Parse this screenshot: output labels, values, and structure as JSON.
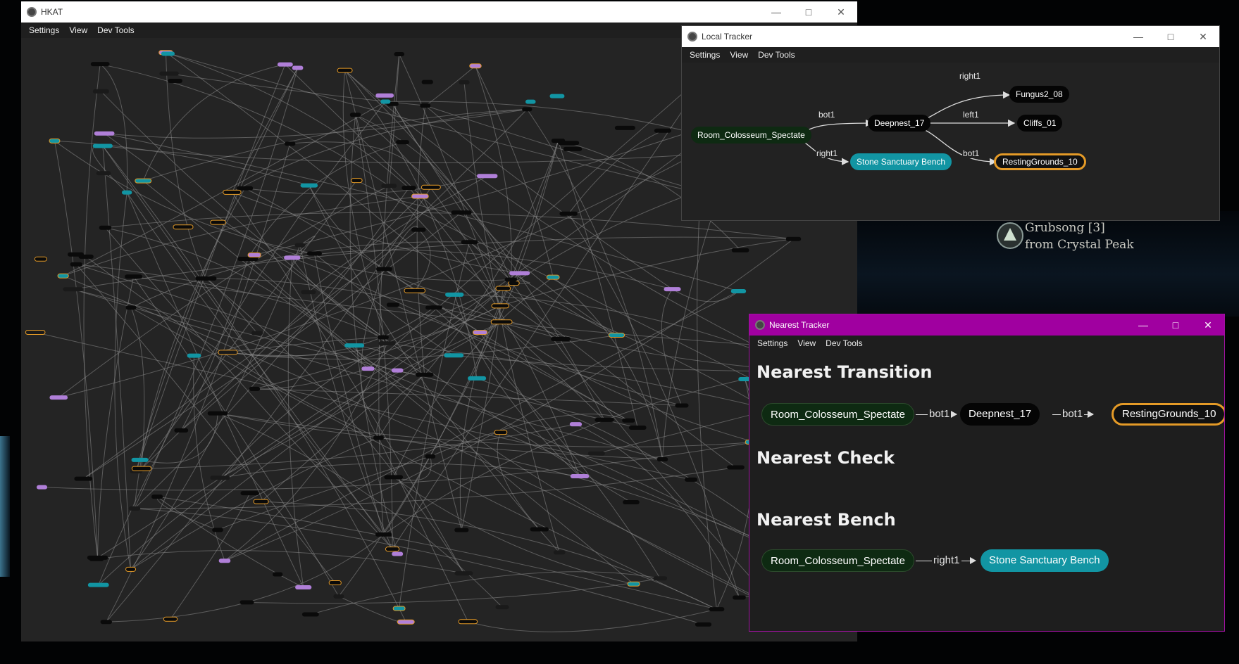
{
  "background": {
    "notice_line1": "Grubsong [3]",
    "notice_line2": "from Crystal Peak"
  },
  "hkat": {
    "title": "HKAT",
    "menu": [
      "Settings",
      "View",
      "Dev Tools"
    ]
  },
  "local_tracker": {
    "title": "Local Tracker",
    "menu": [
      "Settings",
      "View",
      "Dev Tools"
    ],
    "nodes": {
      "origin": "Room_Colosseum_Spectate",
      "deepnest": "Deepnest_17",
      "bench": "Stone Sanctuary Bench",
      "fungus": "Fungus2_08",
      "cliffs": "Cliffs_01",
      "resting": "RestingGrounds_10"
    },
    "edges": {
      "origin_deepnest": "bot1",
      "origin_bench": "right1",
      "deepnest_fungus": "right1",
      "deepnest_cliffs": "left1",
      "deepnest_resting": "bot1"
    }
  },
  "nearest_tracker": {
    "title": "Nearest Tracker",
    "menu": [
      "Settings",
      "View",
      "Dev Tools"
    ],
    "transition": {
      "heading": "Nearest Transition",
      "nodes": [
        "Room_Colosseum_Spectate",
        "Deepnest_17",
        "RestingGrounds_10"
      ],
      "edges": [
        "bot1",
        "bot1"
      ]
    },
    "check": {
      "heading": "Nearest Check"
    },
    "bench": {
      "heading": "Nearest Bench",
      "nodes": [
        "Room_Colosseum_Spectate",
        "Stone Sanctuary Bench"
      ],
      "edges": [
        "right1"
      ]
    }
  },
  "colors": {
    "accent_purple": "#a000a0",
    "node_teal": "#1295a3",
    "node_orange_border": "#e49a27",
    "node_green": "#0e2a12"
  }
}
